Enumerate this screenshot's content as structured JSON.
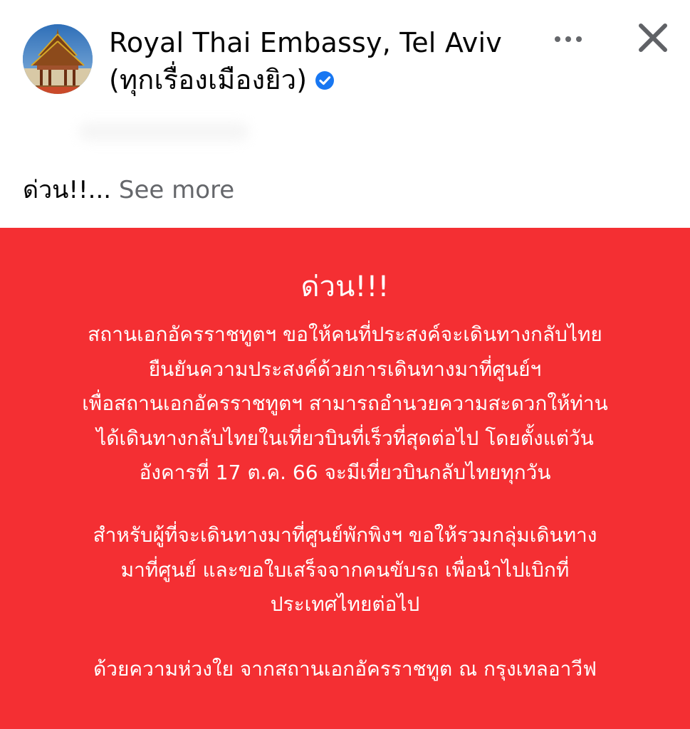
{
  "header": {
    "page_name_line1": "Royal Thai Embassy, Tel Aviv",
    "page_name_line2": "(ทุกเรื่องเมืองยิว)",
    "verified_icon": "verified-badge-icon",
    "more_icon": "more-dots-icon",
    "close_icon": "close-icon"
  },
  "post": {
    "text": "ด่วน!!...",
    "see_more": "See more"
  },
  "notice": {
    "heading": "ด่วน!!!",
    "paragraph1": [
      "สถานเอกอัครราชทูตฯ ขอให้คนที่ประสงค์จะเดินทางกลับไทย",
      "ยืนยันความประสงค์ด้วยการเดินทางมาที่ศูนย์ฯ",
      "เพื่อสถานเอกอัครราชทูตฯ สามารถอำนวยความสะดวกให้ท่าน",
      "ได้เดินทางกลับไทยในเที่ยวบินที่เร็วที่สุดต่อไป โดยตั้งแต่วัน",
      "อังคารที่ 17 ต.ค. 66 จะมีเที่ยวบินกลับไทยทุกวัน"
    ],
    "paragraph2": [
      "สำหรับผู้ที่จะเดินทางมาที่ศูนย์พักพิงฯ ขอให้รวมกลุ่มเดินทาง",
      "มาที่ศูนย์ และขอใบเสร็จจากคนขับรถ เพื่อนำไปเบิกที่",
      "ประเทศไทยต่อไป"
    ],
    "signature": "ด้วยความห่วงใย จากสถานเอกอัครราชทูต ณ กรุงเทลอาวีฟ"
  },
  "colors": {
    "card_background": "#f42f33",
    "verified_blue": "#1877f2",
    "name_text": "#050505",
    "see_more_text": "#65676b"
  }
}
